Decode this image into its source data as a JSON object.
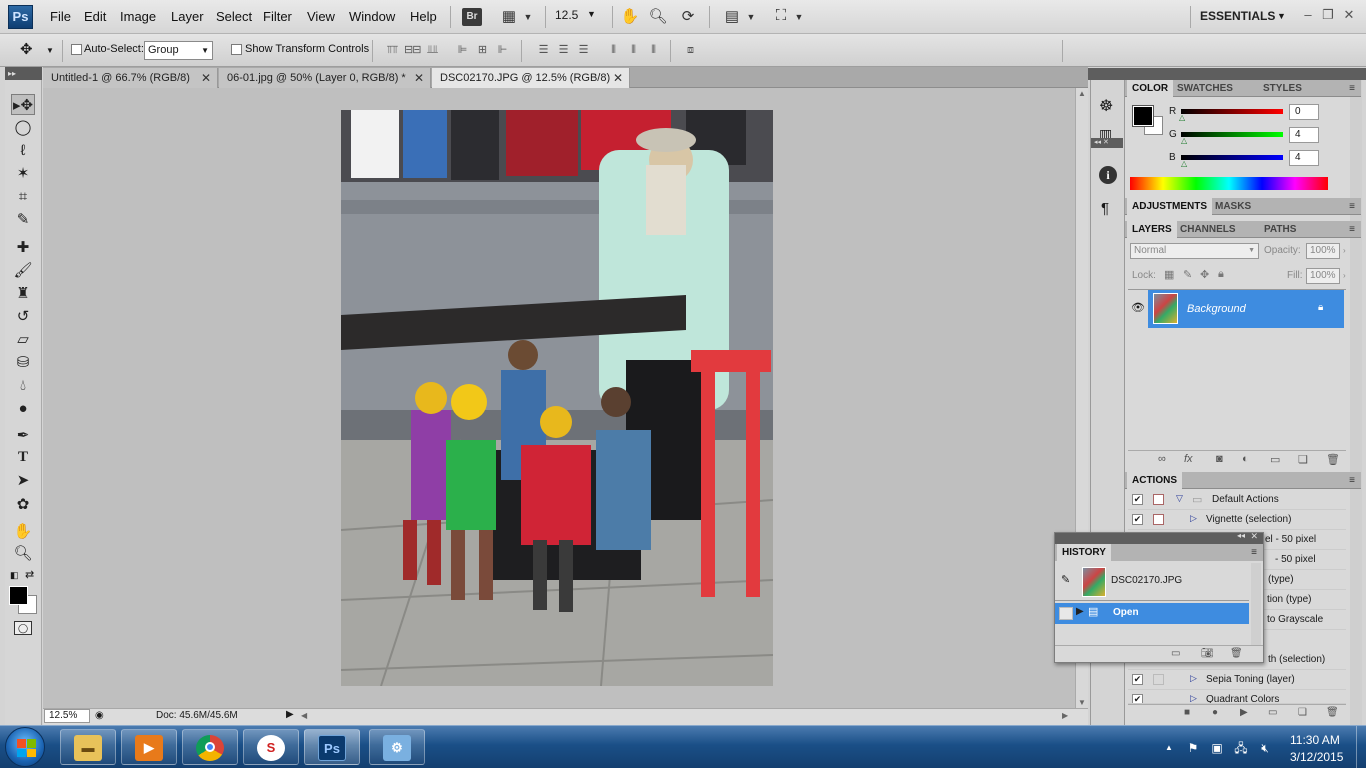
{
  "app": {
    "logo_text": "Ps",
    "menu": [
      "File",
      "Edit",
      "Image",
      "Layer",
      "Select",
      "Filter",
      "View",
      "Window",
      "Help"
    ],
    "bridge_label": "Br",
    "zoom_select": "12.5",
    "workspace_label": "ESSENTIALS",
    "window_controls": [
      "minimize-icon",
      "restore-icon",
      "close-icon"
    ]
  },
  "options": {
    "auto_select_label": "Auto-Select:",
    "auto_select_value": "Group",
    "show_transform_label": "Show Transform Controls"
  },
  "tabs": [
    {
      "label": "Untitled-1 @ 66.7% (RGB/8)",
      "active": false
    },
    {
      "label": "06-01.jpg @ 50% (Layer 0, RGB/8) *",
      "active": false
    },
    {
      "label": "DSC02170.JPG @ 12.5% (RGB/8)",
      "active": true
    }
  ],
  "tools": [
    "move-tool-icon",
    "marquee-tool-icon",
    "lasso-tool-icon",
    "magic-wand-icon",
    "crop-tool-icon",
    "eyedropper-icon",
    "healing-brush-icon",
    "brush-tool-icon",
    "clone-stamp-icon",
    "history-brush-icon",
    "eraser-icon",
    "paint-bucket-icon",
    "blur-tool-icon",
    "dodge-tool-icon",
    "pen-tool-icon",
    "type-tool-icon",
    "path-selection-icon",
    "shape-tool-icon",
    "hand-tool-icon",
    "zoom-tool-icon"
  ],
  "status": {
    "zoom": "12.5%",
    "doc": "Doc: 45.6M/45.6M"
  },
  "color_panel": {
    "tabs": [
      "COLOR",
      "SWATCHES",
      "STYLES"
    ],
    "r_label": "R",
    "g_label": "G",
    "b_label": "B",
    "r": "0",
    "g": "4",
    "b": "4"
  },
  "adjustments": {
    "tabs": [
      "ADJUSTMENTS",
      "MASKS"
    ]
  },
  "layers_panel": {
    "tabs": [
      "LAYERS",
      "CHANNELS",
      "PATHS"
    ],
    "blend_mode": "Normal",
    "opacity_label": "Opacity:",
    "opacity": "100%",
    "lock_label": "Lock:",
    "fill_label": "Fill:",
    "fill": "100%",
    "layer_name": "Background"
  },
  "actions_panel": {
    "tab": "ACTIONS",
    "rows": [
      "Default Actions",
      "Vignette (selection)",
      "el - 50 pixel",
      "- 50 pixel",
      "(type)",
      "tion (type)",
      "to Grayscale",
      "th (selection)",
      "Sepia Toning (layer)",
      "Quadrant Colors"
    ]
  },
  "history_panel": {
    "tab": "HISTORY",
    "snapshot": "DSC02170.JPG",
    "state": "Open"
  },
  "taskbar": {
    "time": "11:30 AM",
    "date": "3/12/2015",
    "ps_label": "Ps"
  }
}
